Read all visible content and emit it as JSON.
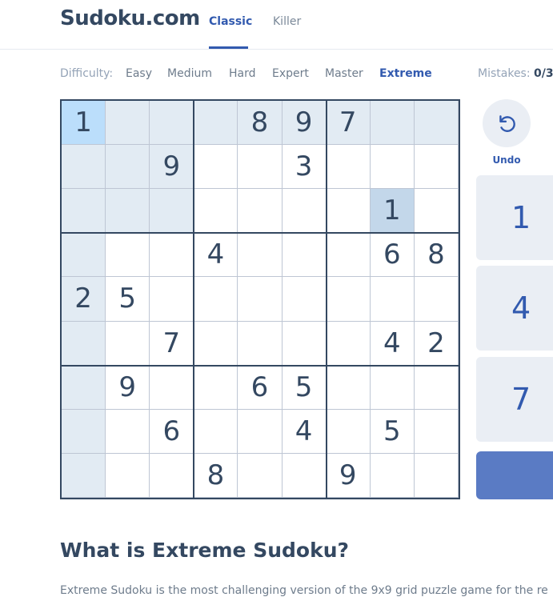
{
  "header": {
    "logo": "Sudoku.com",
    "tabs": [
      {
        "label": "Classic",
        "active": true
      },
      {
        "label": "Killer",
        "active": false
      }
    ]
  },
  "difficulty": {
    "label": "Difficulty:",
    "options": [
      "Easy",
      "Medium",
      "Hard",
      "Expert",
      "Master",
      "Extreme"
    ],
    "selected": "Extreme"
  },
  "mistakes": {
    "label": "Mistakes:",
    "value": "0/3"
  },
  "board": {
    "grid": [
      [
        1,
        0,
        0,
        0,
        8,
        9,
        7,
        0,
        0
      ],
      [
        0,
        0,
        9,
        0,
        0,
        3,
        0,
        0,
        0
      ],
      [
        0,
        0,
        0,
        0,
        0,
        0,
        0,
        1,
        0
      ],
      [
        0,
        0,
        0,
        4,
        0,
        0,
        0,
        6,
        8
      ],
      [
        2,
        5,
        0,
        0,
        0,
        0,
        0,
        0,
        0
      ],
      [
        0,
        0,
        7,
        0,
        0,
        0,
        0,
        4,
        2
      ],
      [
        0,
        9,
        0,
        0,
        6,
        5,
        0,
        0,
        0
      ],
      [
        0,
        0,
        6,
        0,
        0,
        4,
        0,
        5,
        0
      ],
      [
        0,
        0,
        0,
        8,
        0,
        0,
        9,
        0,
        0
      ]
    ],
    "selected_cell": {
      "row": 0,
      "col": 0
    }
  },
  "controls": {
    "undo_label": "Undo",
    "undo_icon": "undo-icon",
    "number_pad": [
      "1",
      "4",
      "7"
    ]
  },
  "about": {
    "title": "What is Extreme Sudoku?",
    "text": "Extreme Sudoku is the most challenging version of the 9x9 grid puzzle game for the re"
  },
  "colors": {
    "accent": "#325aaf",
    "text": "#344861",
    "highlight": "#e2ebf3",
    "selected": "#bbdefb",
    "same_number": "#c3d7ea"
  }
}
